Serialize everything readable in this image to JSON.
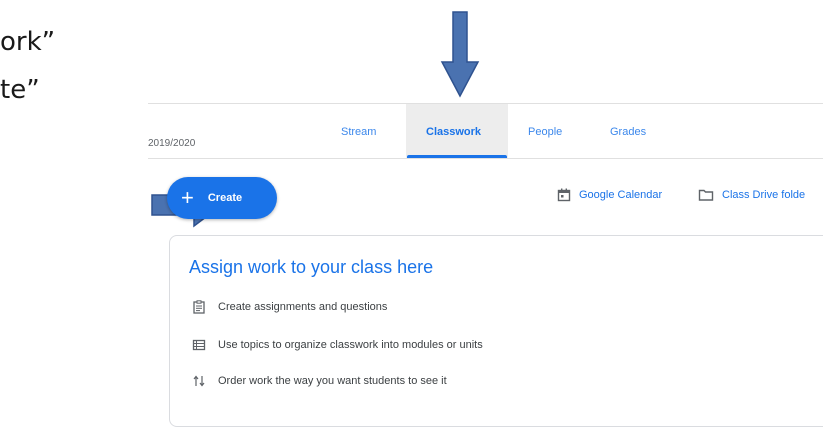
{
  "slide": {
    "line1": "ork”",
    "line2": "te”"
  },
  "header": {
    "term": "2019/2020",
    "tabs": [
      {
        "label": "Stream"
      },
      {
        "label": "Classwork"
      },
      {
        "label": "People"
      },
      {
        "label": "Grades"
      }
    ]
  },
  "toolbar": {
    "create_label": "Create",
    "create_icon": "plus-icon",
    "calendar_label": "Google Calendar",
    "calendar_icon": "calendar-icon",
    "drive_label": "Class Drive folde",
    "drive_icon": "folder-icon"
  },
  "card": {
    "title": "Assign work to your class here",
    "items": [
      {
        "icon": "assignment-icon",
        "text": "Create assignments and questions"
      },
      {
        "icon": "topics-icon",
        "text": "Use topics to organize classwork into modules or units"
      },
      {
        "icon": "reorder-icon",
        "text": "Order work the way you want students to see it"
      }
    ]
  },
  "colors": {
    "accent": "#1a73e8",
    "arrow": "#4a72b0",
    "arrow_border": "#2f528f"
  }
}
